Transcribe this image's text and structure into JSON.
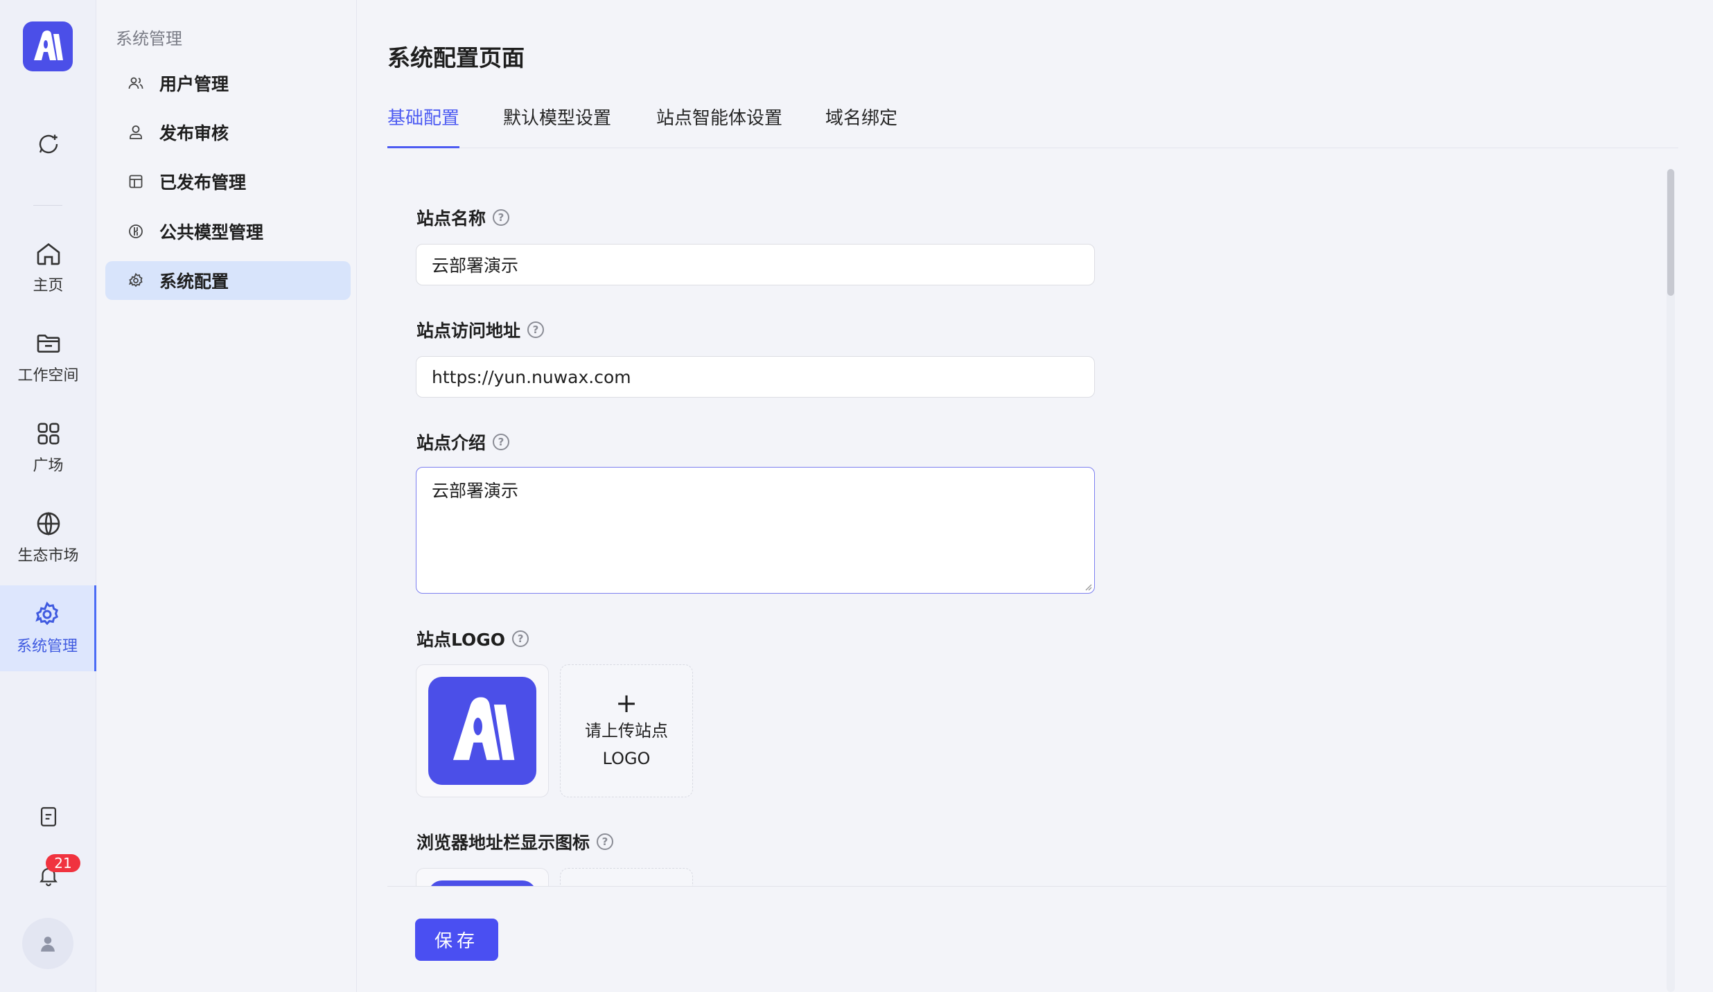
{
  "rail": {
    "items": [
      {
        "icon": "home-icon",
        "label": "主页"
      },
      {
        "icon": "folder-icon",
        "label": "工作空间"
      },
      {
        "icon": "grid-icon",
        "label": "广场"
      },
      {
        "icon": "globe-icon",
        "label": "生态市场"
      },
      {
        "icon": "gear-icon",
        "label": "系统管理"
      }
    ],
    "notification_count": "21",
    "accent": "#4b4fe8"
  },
  "subnav": {
    "title": "系统管理",
    "items": [
      {
        "icon": "users-icon",
        "label": "用户管理"
      },
      {
        "icon": "user-review-icon",
        "label": "发布审核"
      },
      {
        "icon": "layout-icon",
        "label": "已发布管理"
      },
      {
        "icon": "model-icon",
        "label": "公共模型管理"
      },
      {
        "icon": "gear-icon",
        "label": "系统配置"
      }
    ],
    "active_index": 4
  },
  "main": {
    "page_title": "系统配置页面",
    "tabs": [
      {
        "label": "基础配置"
      },
      {
        "label": "默认模型设置"
      },
      {
        "label": "站点智能体设置"
      },
      {
        "label": "域名绑定"
      }
    ],
    "active_tab": 0,
    "form": {
      "site_name": {
        "label": "站点名称",
        "value": "云部署演示"
      },
      "site_url": {
        "label": "站点访问地址",
        "value": "https://yun.nuwax.com"
      },
      "site_intro": {
        "label": "站点介绍",
        "value": "云部署演示"
      },
      "site_logo": {
        "label": "站点LOGO",
        "upload_text": "请上传站点LOGO"
      },
      "favicon": {
        "label": "浏览器地址栏显示图标"
      }
    },
    "save_label": "保存"
  }
}
